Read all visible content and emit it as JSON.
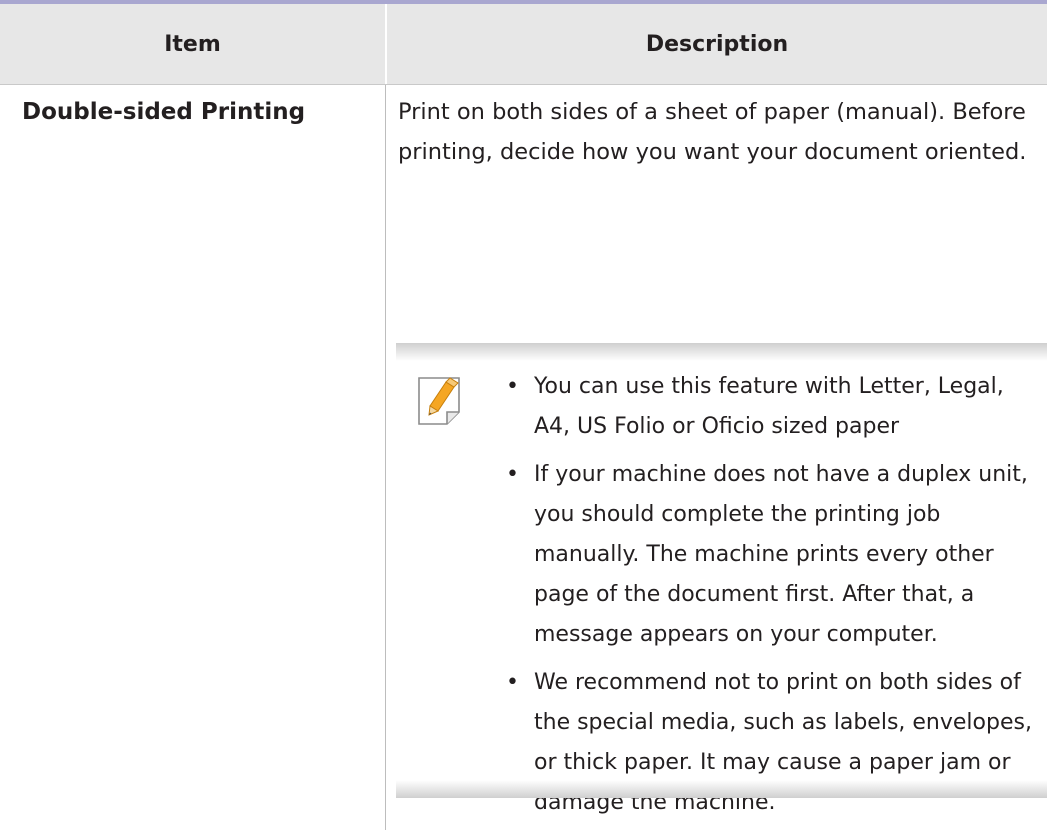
{
  "table": {
    "headers": {
      "item": "Item",
      "description": "Description"
    },
    "row": {
      "item": "Double-sided Printing",
      "description": "Print on both sides of a sheet of paper (manual). Before printing, decide how you want your document oriented."
    }
  },
  "note": {
    "icon": "note-pencil-icon",
    "bullets": [
      "You can use this feature with Letter, Legal, A4, US Folio or Oficio sized paper",
      "If your machine does not have a duplex unit, you should complete the printing job manually. The machine prints every other page of the document first. After that, a message appears on your computer.",
      "We recommend not to print on both sides of the special media, such as labels, envelopes, or thick paper. It may cause a paper jam or damage the machine."
    ]
  },
  "colors": {
    "top_rule": "#a9a7d0",
    "header_bg": "#e7e7e7",
    "text": "#231f20",
    "icon_orange": "#f5a623"
  }
}
